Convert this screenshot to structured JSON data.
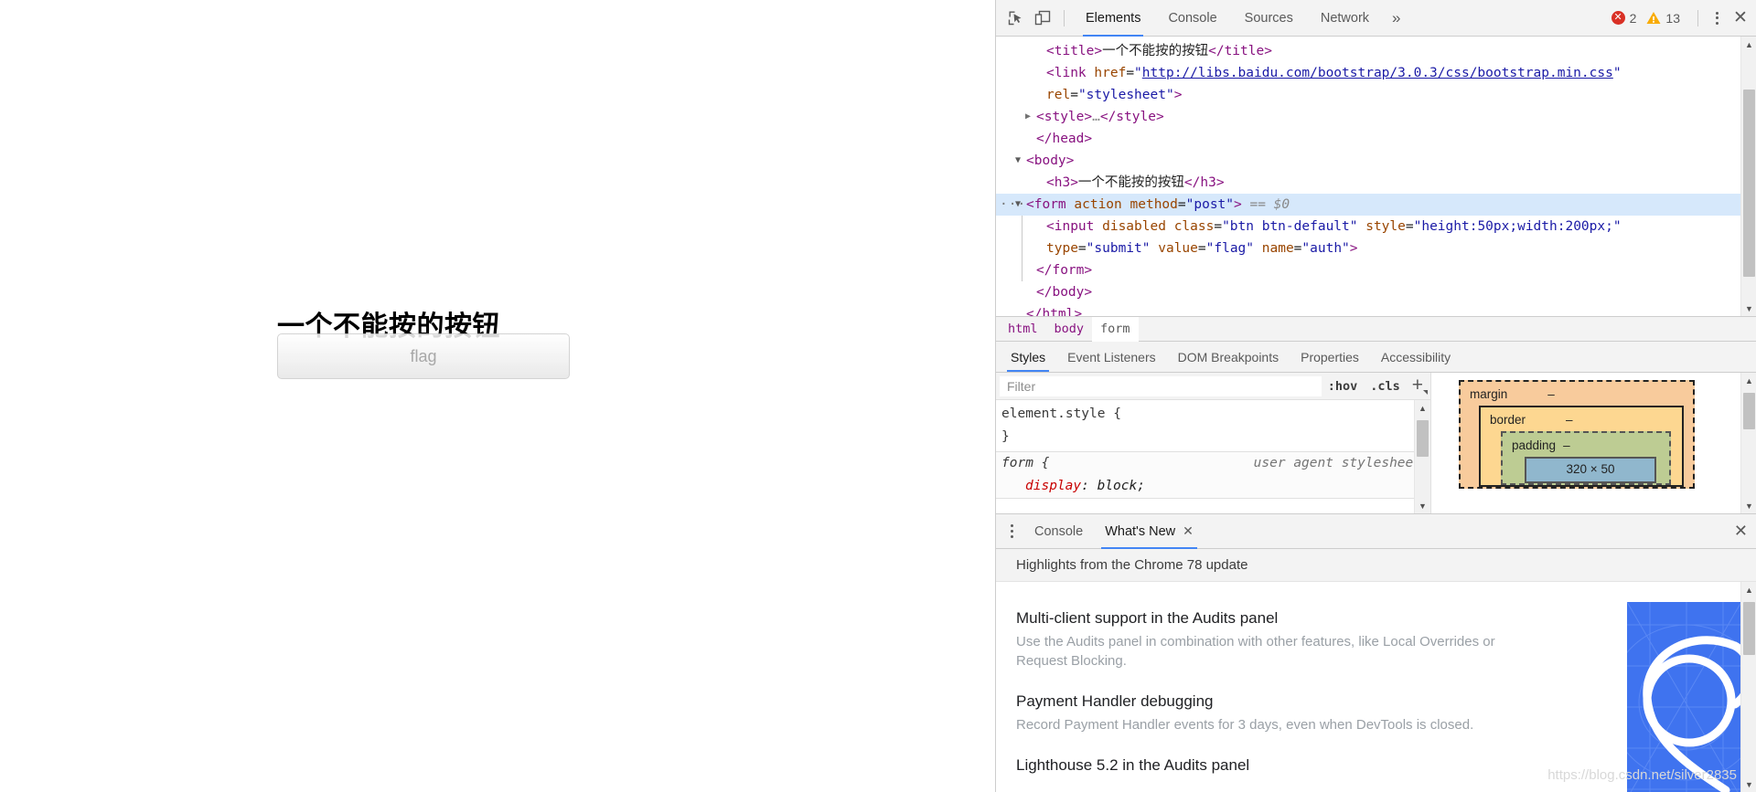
{
  "page": {
    "heading": "一个不能按的按钮",
    "button_value": "flag"
  },
  "devtools": {
    "toolbar": {
      "inspect_icon": "inspect-cursor-icon",
      "device_icon": "device-toolbar-icon",
      "tabs": [
        {
          "label": "Elements",
          "active": true
        },
        {
          "label": "Console",
          "active": false
        },
        {
          "label": "Sources",
          "active": false
        },
        {
          "label": "Network",
          "active": false
        }
      ],
      "more_tabs": "»",
      "error_count": "2",
      "warning_count": "13",
      "menu_icon": "kebab-menu-icon",
      "close_icon": "close-icon"
    },
    "dom": [
      {
        "indent": 3,
        "html": "<span class=\"tw\">&lt;title&gt;</span><span class=\"txt\">一个不能按的按钮</span><span class=\"tw\">&lt;/title&gt;</span>"
      },
      {
        "indent": 3,
        "html": "<span class=\"tw\">&lt;link </span><span class=\"at\">href</span><span class=\"txt\">=</span><span class=\"av\">\"</span><span class=\"lnk\">http://libs.baidu.com/bootstrap/3.0.3/css/bootstrap.min.css</span><span class=\"av\">\"</span>"
      },
      {
        "indent": 3,
        "html": "<span class=\"at\">rel</span><span class=\"txt\">=</span><span class=\"av\">\"stylesheet\"</span><span class=\"tw\">&gt;</span>"
      },
      {
        "indent": 2,
        "html": "<span class=\"tw\">&lt;style&gt;</span><span class=\"dim\">…</span><span class=\"tw\">&lt;/style&gt;</span>",
        "caret": "collapsed"
      },
      {
        "indent": 2,
        "html": "<span class=\"tw\">&lt;/head&gt;</span>"
      },
      {
        "indent": 1,
        "html": "<span class=\"tw\">&lt;body&gt;</span>",
        "caret": "expanded"
      },
      {
        "indent": 3,
        "html": "<span class=\"tw\">&lt;h3&gt;</span><span class=\"txt\">一个不能按的按钮</span><span class=\"tw\">&lt;/h3&gt;</span>"
      },
      {
        "indent": 1,
        "html": "<span class=\"tw\">&lt;form </span><span class=\"at\">action</span><span class=\"txt\"> </span><span class=\"at\">method</span><span class=\"txt\">=</span><span class=\"av\">\"post\"</span><span class=\"tw\">&gt;</span><span class=\"eq\"> == $0</span>",
        "caret": "expanded",
        "selected": true,
        "dots": true
      },
      {
        "indent": 3,
        "html": "<span class=\"tw\">&lt;input </span><span class=\"at\">disabled</span><span class=\"txt\"> </span><span class=\"at\">class</span><span class=\"txt\">=</span><span class=\"av\">\"btn btn-default\"</span><span class=\"txt\"> </span><span class=\"at\">style</span><span class=\"txt\">=</span><span class=\"av\">\"height:50px;width:200px;\"</span>",
        "guide": true
      },
      {
        "indent": 3,
        "html": "<span class=\"at\">type</span><span class=\"txt\">=</span><span class=\"av\">\"submit\"</span><span class=\"txt\"> </span><span class=\"at\">value</span><span class=\"txt\">=</span><span class=\"av\">\"flag\"</span><span class=\"txt\"> </span><span class=\"at\">name</span><span class=\"txt\">=</span><span class=\"av\">\"auth\"</span><span class=\"tw\">&gt;</span>",
        "guide": true
      },
      {
        "indent": 2,
        "html": "<span class=\"tw\">&lt;/form&gt;</span>",
        "guide": true
      },
      {
        "indent": 2,
        "html": "<span class=\"tw\">&lt;/body&gt;</span>"
      },
      {
        "indent": 1,
        "html": "<span class=\"tw\">&lt;/html&gt;</span>"
      }
    ],
    "breadcrumb": [
      {
        "label": "html",
        "active": false
      },
      {
        "label": "body",
        "active": false
      },
      {
        "label": "form",
        "active": true
      }
    ],
    "sidebar_tabs": [
      {
        "label": "Styles",
        "active": true
      },
      {
        "label": "Event Listeners",
        "active": false
      },
      {
        "label": "DOM Breakpoints",
        "active": false
      },
      {
        "label": "Properties",
        "active": false
      },
      {
        "label": "Accessibility",
        "active": false
      }
    ],
    "styles": {
      "filter_placeholder": "Filter",
      "filter_value": "",
      "hov_label": ":hov",
      "cls_label": ".cls",
      "new_rule_label": "+",
      "element_style_selector": "element.style {",
      "element_style_close": "}",
      "ua_rule_selector": "form {",
      "ua_rule_origin": "user agent stylesheet",
      "ua_prop_name": "display",
      "ua_prop_value": "block;"
    },
    "box_model": {
      "margin_label": "margin",
      "margin_value": "–",
      "border_label": "border",
      "border_value": "–",
      "padding_label": "padding",
      "padding_value": "–",
      "content_size": "320 × 50"
    },
    "drawer": {
      "menu_icon": "kebab-menu-icon",
      "tabs": [
        {
          "label": "Console",
          "active": false,
          "closable": false
        },
        {
          "label": "What's New",
          "active": true,
          "closable": true,
          "close_glyph": "✕"
        }
      ],
      "close_glyph": "✕",
      "whats_new": {
        "header": "Highlights from the Chrome 78 update",
        "items": [
          {
            "title": "Multi-client support in the Audits panel",
            "desc": "Use the Audits panel in combination with other features, like Local Overrides or Request Blocking."
          },
          {
            "title": "Payment Handler debugging",
            "desc": "Record Payment Handler events for 3 days, even when DevTools is closed."
          },
          {
            "title": "Lighthouse 5.2 in the Audits panel",
            "desc": ""
          }
        ]
      }
    }
  },
  "watermark": "https://blog.csdn.net/silver2835",
  "colors": {
    "accent": "#4285f4",
    "error": "#d93025",
    "warning": "#f9ab00",
    "tag": "#881280",
    "attr_name": "#994500",
    "attr_value": "#1a1aa6",
    "selected_row": "#d6e8fb"
  }
}
